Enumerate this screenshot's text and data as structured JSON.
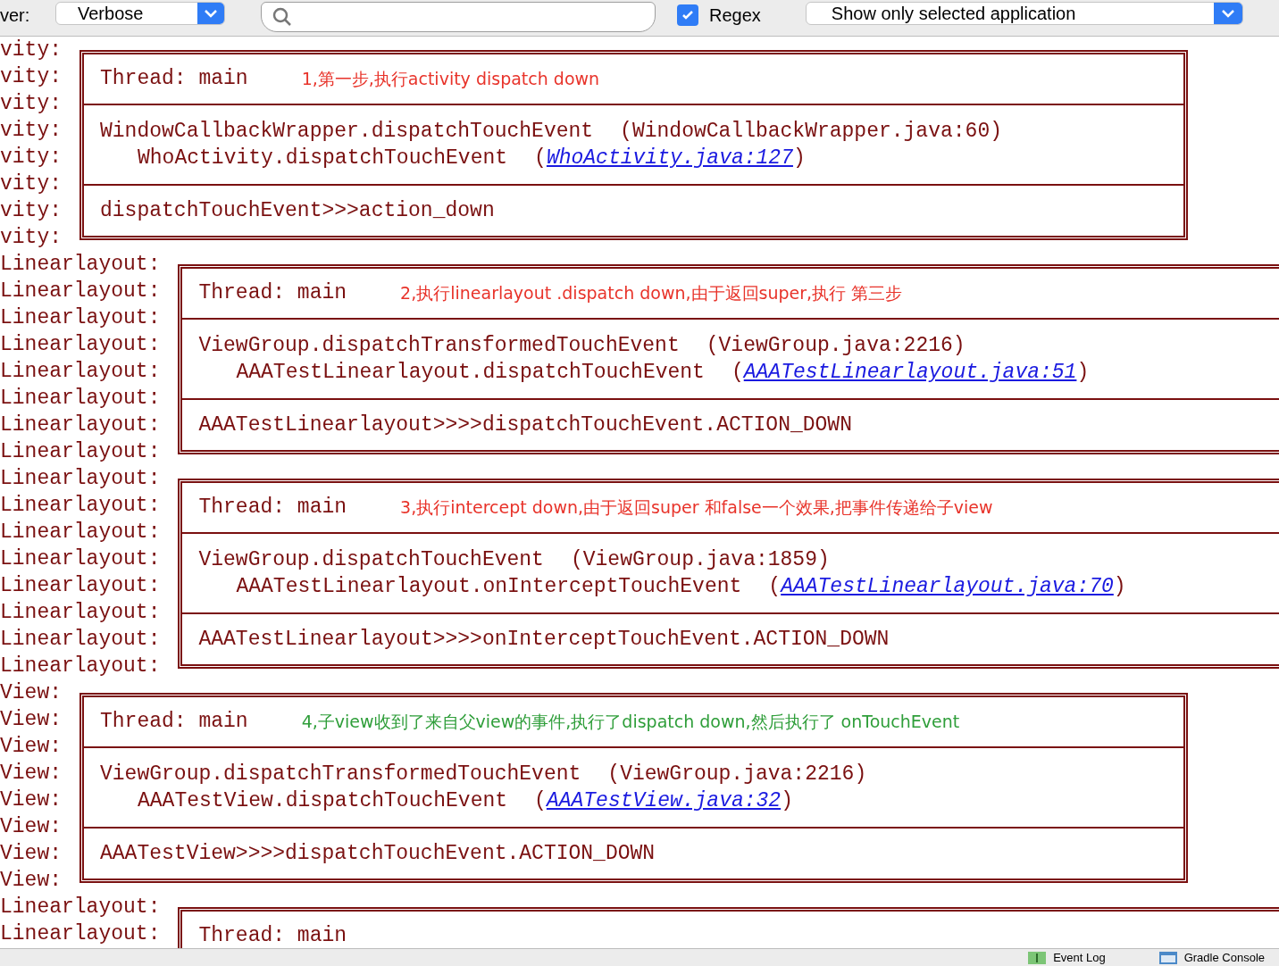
{
  "toolbar": {
    "level_label": "ver:",
    "level_dropdown": "Verbose",
    "regex": {
      "label": "Regex",
      "checked": true
    },
    "filter_dropdown": "Show only selected application"
  },
  "log_blocks": [
    {
      "tags": [
        "vity:",
        "vity:",
        "vity:",
        "vity:",
        "vity:",
        "vity:",
        "vity:",
        "vity:"
      ],
      "thread": "Thread: main",
      "annotation": {
        "text": "1,第一步,执行activity dispatch down",
        "color": "#e8332a"
      },
      "stack": [
        {
          "call": "WindowCallbackWrapper.dispatchTouchEvent",
          "open": "(",
          "location": "WindowCallbackWrapper.java:60",
          "close": ")",
          "link": false
        },
        {
          "call": "WhoActivity.dispatchTouchEvent",
          "open": "(",
          "location": "WhoActivity.java:127",
          "close": ")",
          "link": true
        }
      ],
      "message": "dispatchTouchEvent>>>action_down"
    },
    {
      "tags": [
        "Linearlayout:",
        "Linearlayout:",
        "Linearlayout:",
        "Linearlayout:",
        "Linearlayout:",
        "Linearlayout:",
        "Linearlayout:",
        "Linearlayout:"
      ],
      "thread": "Thread: main",
      "annotation": {
        "text": "2,执行linearlayout .dispatch down,由于返回super,执行 第三步",
        "color": "#e8332a"
      },
      "stack": [
        {
          "call": "ViewGroup.dispatchTransformedTouchEvent",
          "open": "(",
          "location": "ViewGroup.java:2216",
          "close": ")",
          "link": false
        },
        {
          "call": "AAATestLinearlayout.dispatchTouchEvent",
          "open": "(",
          "location": "AAATestLinearlayout.java:51",
          "close": ")",
          "link": true
        }
      ],
      "message": "AAATestLinearlayout>>>>dispatchTouchEvent.ACTION_DOWN"
    },
    {
      "tags": [
        "Linearlayout:",
        "Linearlayout:",
        "Linearlayout:",
        "Linearlayout:",
        "Linearlayout:",
        "Linearlayout:",
        "Linearlayout:",
        "Linearlayout:"
      ],
      "thread": "Thread: main",
      "annotation": {
        "text": "3,执行intercept down,由于返回super 和false一个效果,把事件传递给子view",
        "color": "#e8332a"
      },
      "stack": [
        {
          "call": "ViewGroup.dispatchTouchEvent",
          "open": "(",
          "location": "ViewGroup.java:1859",
          "close": ")",
          "link": false
        },
        {
          "call": "AAATestLinearlayout.onInterceptTouchEvent",
          "open": "(",
          "location": "AAATestLinearlayout.java:70",
          "close": ")",
          "link": true
        }
      ],
      "message": "AAATestLinearlayout>>>>onInterceptTouchEvent.ACTION_DOWN"
    },
    {
      "tags": [
        "View:",
        "View:",
        "View:",
        "View:",
        "View:",
        "View:",
        "View:",
        "View:"
      ],
      "thread": "Thread: main",
      "annotation": {
        "text": "4,子view收到了来自父view的事件,执行了dispatch down,然后执行了 onTouchEvent",
        "color": "#2f9e3a"
      },
      "stack": [
        {
          "call": "ViewGroup.dispatchTransformedTouchEvent",
          "open": "(",
          "location": "ViewGroup.java:2216",
          "close": ")",
          "link": false
        },
        {
          "call": "AAATestView.dispatchTouchEvent",
          "open": "(",
          "location": "AAATestView.java:32",
          "close": ")",
          "link": true
        }
      ],
      "message": "AAATestView>>>>dispatchTouchEvent.ACTION_DOWN"
    },
    {
      "tags": [
        "Linearlayout:",
        "Linearlayout:"
      ],
      "thread": "Thread: main"
    }
  ],
  "status_bar": [
    {
      "label": "Event Log",
      "kind": "event"
    },
    {
      "label": "Gradle Console",
      "kind": "console"
    }
  ]
}
